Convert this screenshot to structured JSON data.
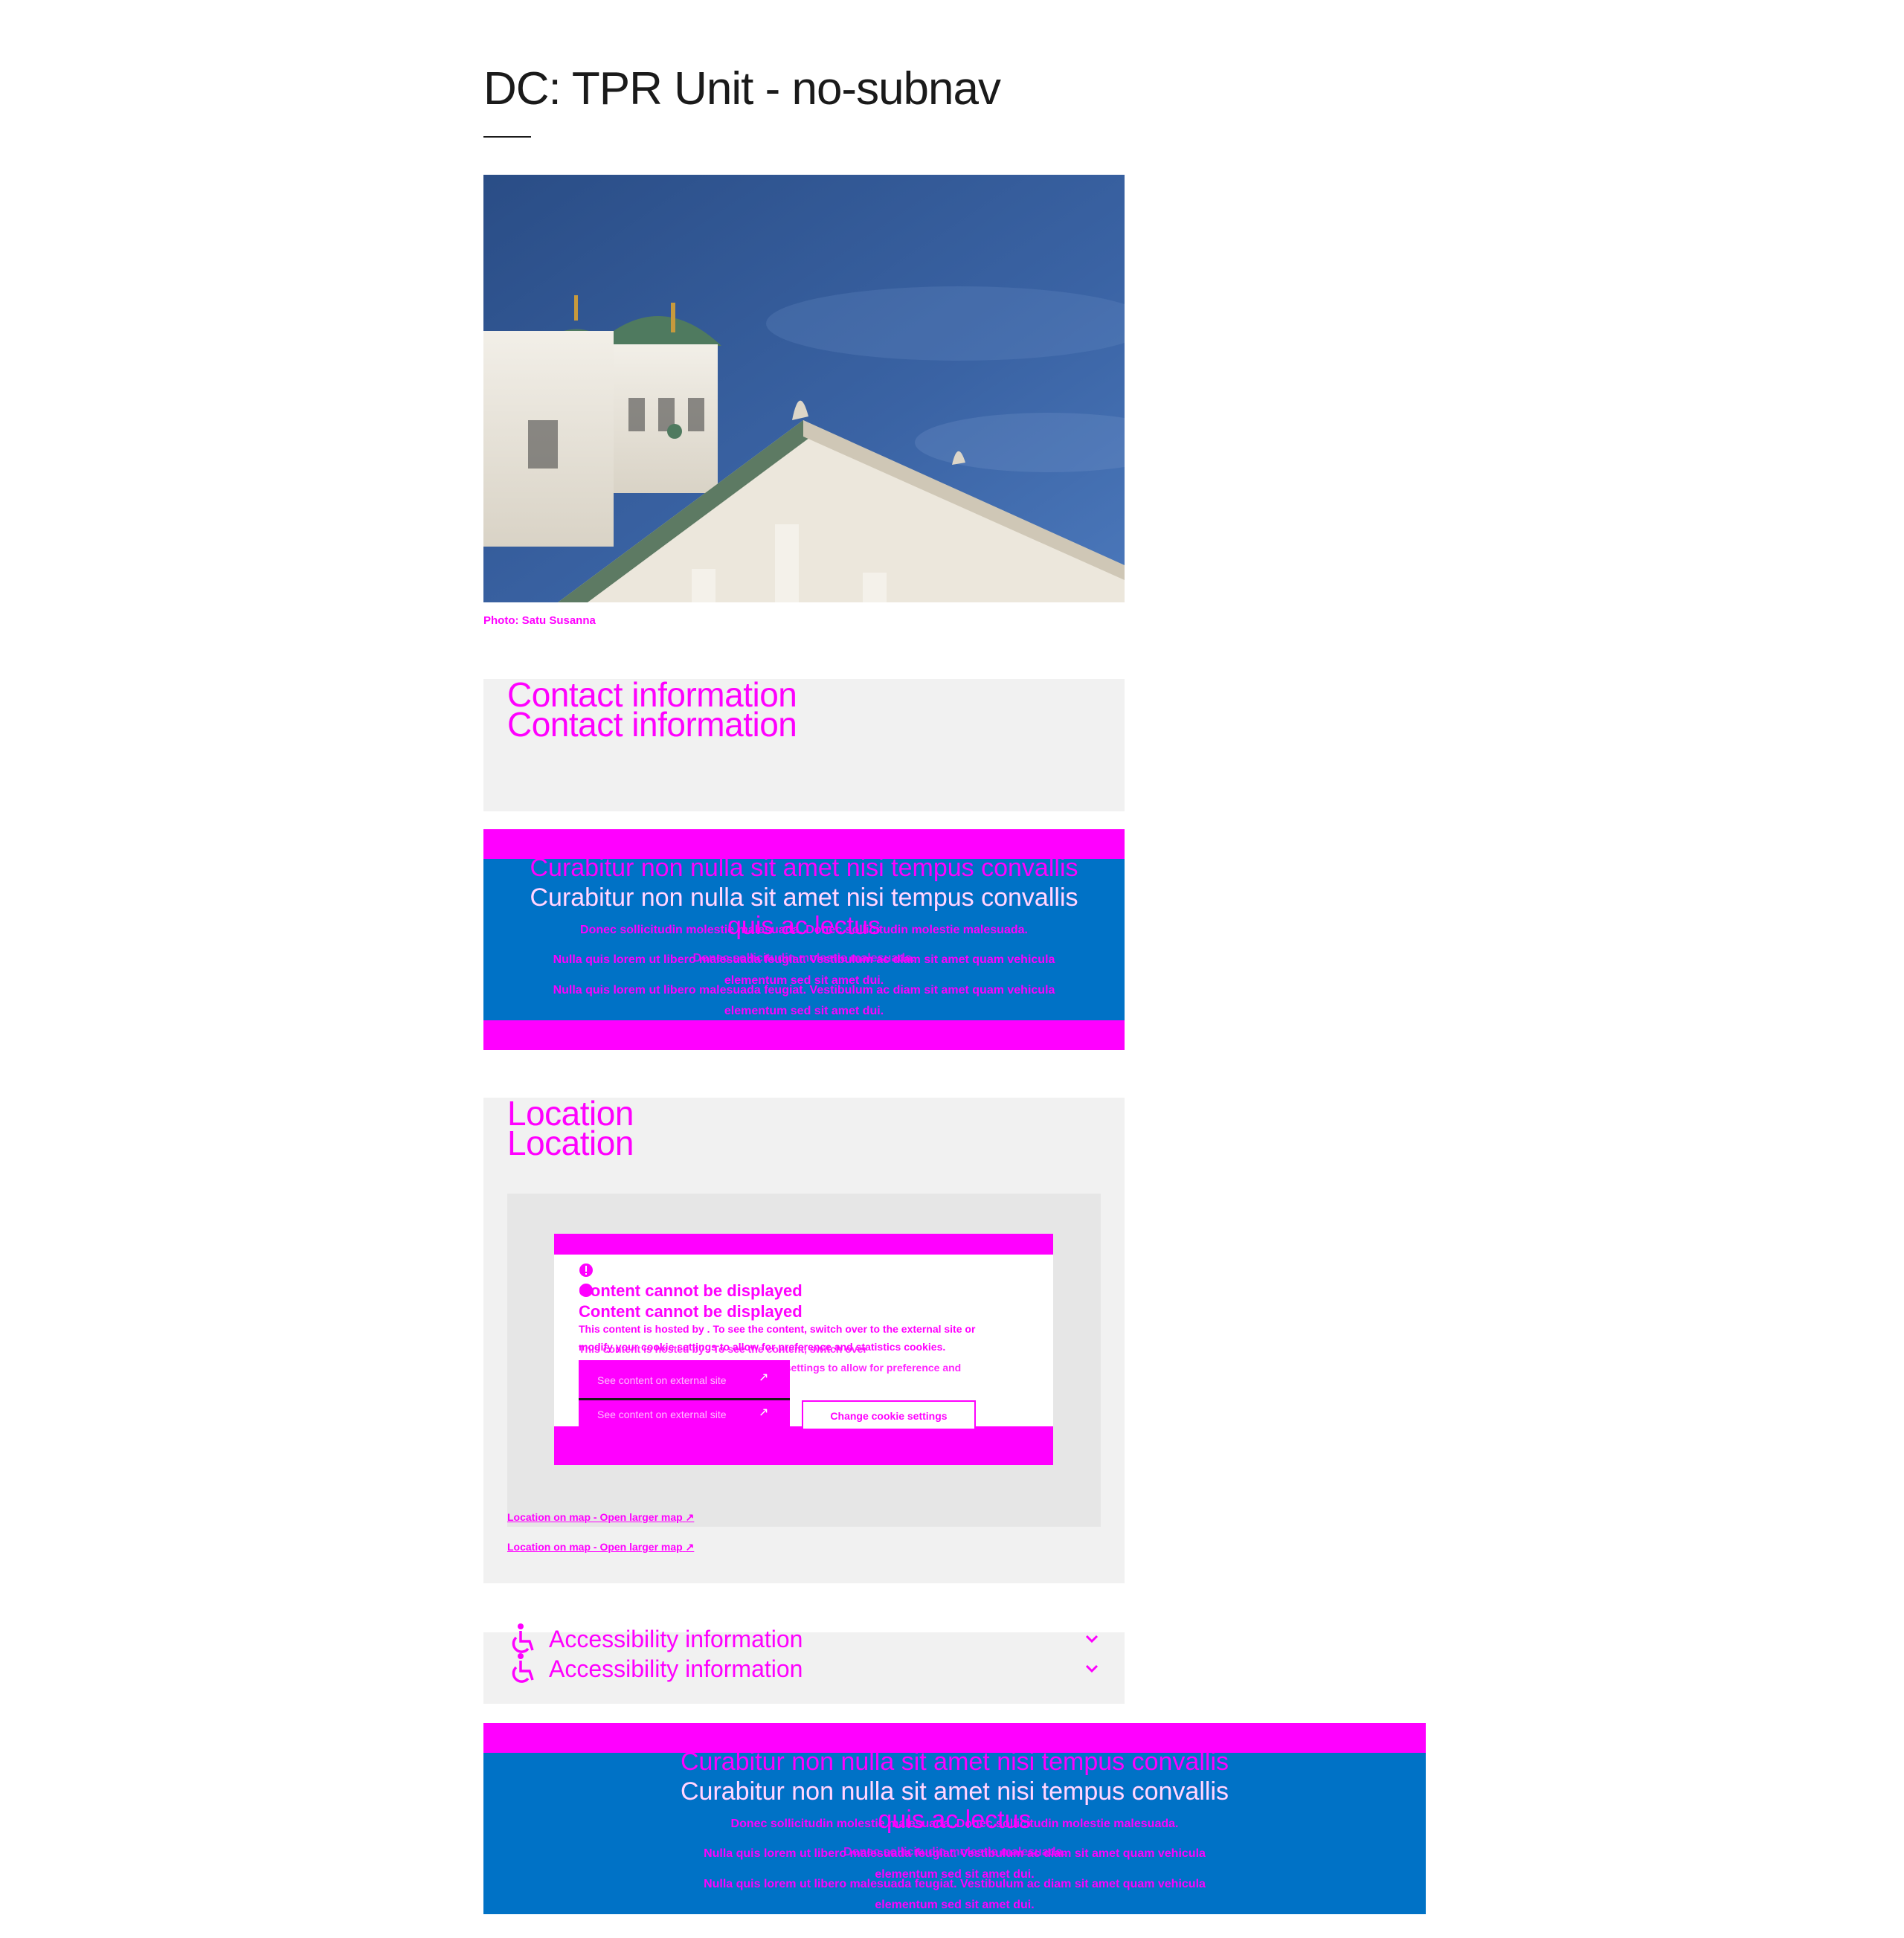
{
  "page": {
    "title": "DC: TPR Unit - no-subnav",
    "photo_caption": "Photo: Satu Susanna"
  },
  "contact": {
    "heading": "Contact information"
  },
  "banner": {
    "heading": "Curabitur non nulla sit amet nisi tempus convallis",
    "heading_overlay_1": "quis ac lectus",
    "paragraph_1": "Donec sollicitudin molestie malesuada. Donec sollicitudin molestie malesuada.",
    "paragraph_2": "Nulla quis lorem ut libero malesuada feugiat. Vestibulum ac diam sit amet quam vehicula",
    "paragraph_2_end": "elementum sed sit amet dui.",
    "overlay_short": "Donec sollicitudin molestie malesuada."
  },
  "location": {
    "heading": "Location",
    "consent": {
      "title": "Content cannot be displayed",
      "text_line_1": "This content is hosted by . To see the content, switch over to the external site or",
      "text_line_2": "modify your cookie settings to allow for preference and statistics cookies.",
      "text_alt_1": "This content is hosted by . To see the content, switch over",
      "text_alt_2": "to the external site or modify your cookie settings to allow for preference and",
      "external_button": "See content on external site",
      "cookie_button": "Change cookie settings"
    },
    "map_link": "Location on map - Open larger map"
  },
  "accessibility": {
    "label": "Accessibility information"
  },
  "colors": {
    "accent": "#ff00ff",
    "banner_blue": "#0072c6",
    "panel_gray": "#f1f1f1"
  }
}
